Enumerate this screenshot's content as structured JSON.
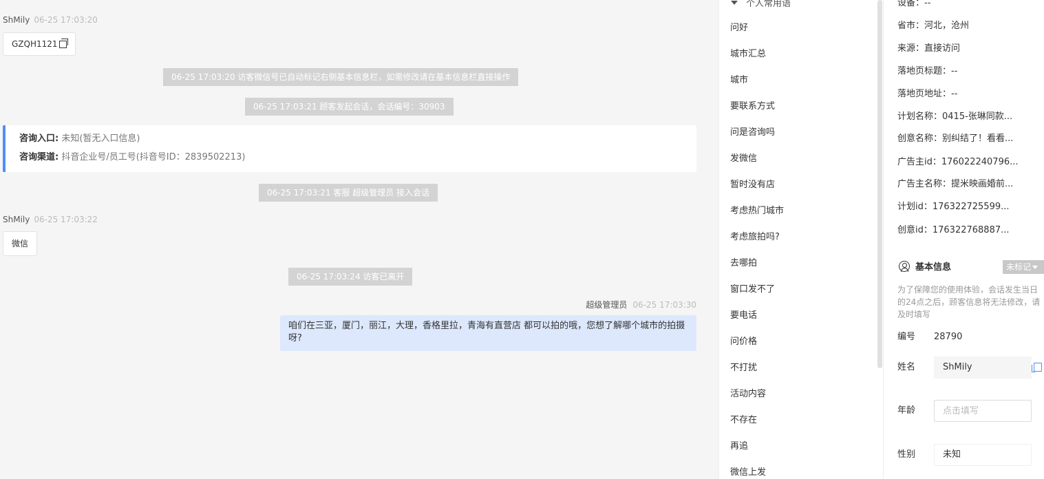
{
  "chat": {
    "msg1": {
      "sender": "ShMily",
      "time": "06-25 17:03:20",
      "text": "GZQH1121"
    },
    "sys1": "06-25 17:03:20 访客微信号已自动标记右侧基本信息栏，如需修改请在基本信息栏直接操作",
    "sys2": "06-25 17:03:21 顾客发起会话，会话编号：30903",
    "card": {
      "entry_label": "咨询入口:",
      "entry_value": "未知(暂无入口信息)",
      "channel_label": "咨询渠道:",
      "channel_value": "抖音企业号/员工号(抖音号ID：2839502213)"
    },
    "sys3": "06-25 17:03:21 客服 超级管理员 接入会话",
    "msg2": {
      "sender": "ShMily",
      "time": "06-25 17:03:22",
      "text": "微信"
    },
    "sys4": "06-25 17:03:24 访客已离开",
    "agent": {
      "name": "超级管理员",
      "time": "06-25 17:03:30",
      "text": "咱们在三亚，厦门，丽江，大理，香格里拉，青海有直营店 都可以拍的哦，您想了解哪个城市的拍摄呀?"
    }
  },
  "phrases": {
    "heading": "个人常用语",
    "items": [
      "问好",
      "城市汇总",
      "城市",
      "要联系方式",
      "问是咨询吗",
      "发微信",
      "暂时没有店",
      "考虑热门城市",
      "考虑旅拍吗?",
      "去哪拍",
      "窗口发不了",
      "要电话",
      "问价格",
      "不打扰",
      "活动内容",
      "不存在",
      "再追",
      "微信上发"
    ]
  },
  "panel": {
    "rows": [
      "设备：--",
      "省市：河北，沧州",
      "来源：直接访问",
      "落地页标题：--",
      "落地页地址：--",
      "计划名称：0415-张琳同款...",
      "创意名称：别纠结了！看看...",
      "广告主id：176022240796...",
      "广告主名称：提米映画婚前...",
      "计划id：176322725599...",
      "创意id：176322768887..."
    ],
    "basic_title": "基本信息",
    "mark_label": "未标记",
    "notice": "为了保障您的使用体验，会话发生当日的24点之后，顾客信息将无法修改，请及时填写",
    "id_label": "编号",
    "id_value": "28790",
    "name_label": "姓名",
    "name_value": "ShMily",
    "age_label": "年龄",
    "age_placeholder": "点击填写",
    "gender_label": "性别",
    "gender_value": "未知"
  }
}
